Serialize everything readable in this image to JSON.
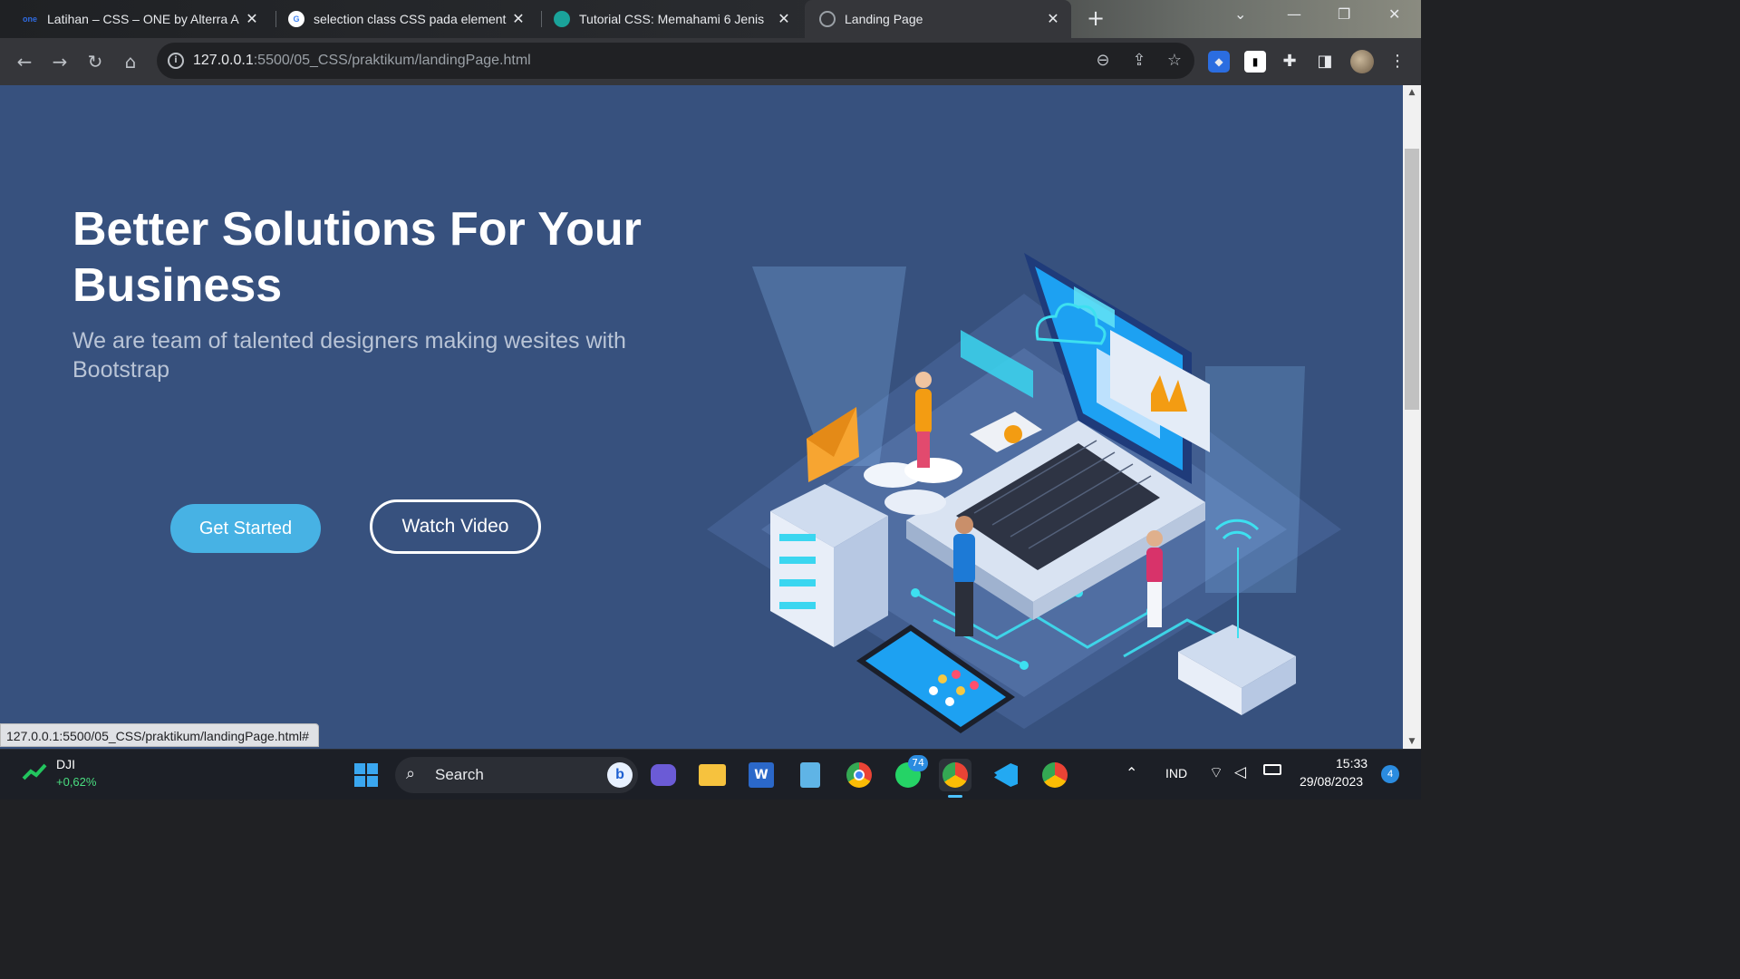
{
  "browser": {
    "tabs": [
      {
        "title": "Latihan – CSS – ONE by Alterra A",
        "favicon_text": "one"
      },
      {
        "title": "selection class CSS pada element",
        "favicon_text": "G"
      },
      {
        "title": "Tutorial CSS: Memahami 6 Jenis",
        "favicon_text": ""
      },
      {
        "title": "Landing Page",
        "favicon_text": "",
        "active": true
      }
    ],
    "url_host": "127.0.0.1",
    "url_path": ":5500/05_CSS/praktikum/landingPage.html",
    "status_url": "127.0.0.1:5500/05_CSS/praktikum/landingPage.html#"
  },
  "page": {
    "hero_title": "Better Solutions For Your Business",
    "hero_subtitle": "We are team of talented designers making wesites with Bootstrap",
    "get_started_label": "Get Started",
    "watch_video_label": "Watch Video"
  },
  "taskbar": {
    "stock_name": "DJI",
    "stock_change": "+0,62%",
    "search_placeholder": "Search",
    "whatsapp_badge": "74",
    "language": "IND",
    "time": "15:33",
    "date": "29/08/2023",
    "notification_count": "4"
  },
  "colors": {
    "page_bg": "#37517e",
    "accent": "#47b2e4",
    "toolbar": "#35363a"
  }
}
